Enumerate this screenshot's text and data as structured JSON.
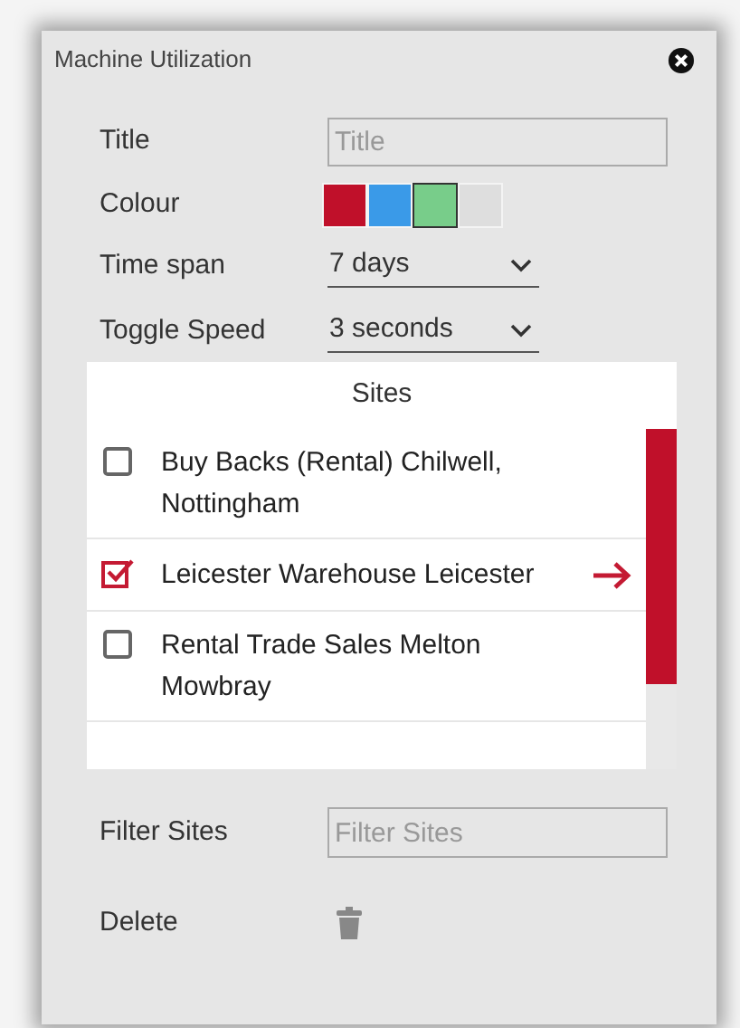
{
  "window": {
    "title": "Machine Utilization"
  },
  "form": {
    "title_label": "Title",
    "title_placeholder": "Title",
    "colour_label": "Colour",
    "colours": [
      {
        "color": "#c0102a",
        "selected": false
      },
      {
        "color": "#3a9ae8",
        "selected": false
      },
      {
        "color": "#78cd8a",
        "selected": true
      },
      {
        "color": "#dedede",
        "selected": false
      }
    ],
    "time_span_label": "Time span",
    "time_span_value": "7 days",
    "toggle_speed_label": "Toggle Speed",
    "toggle_speed_value": "3 seconds"
  },
  "sites": {
    "heading": "Sites",
    "items": [
      {
        "name": "Buy Backs (Rental) Chilwell, Nottingham",
        "checked": false,
        "selected": false
      },
      {
        "name": "Leicester Warehouse Leicester",
        "checked": true,
        "selected": true
      },
      {
        "name": "Rental Trade Sales Melton Mowbray",
        "checked": false,
        "selected": false
      }
    ]
  },
  "filter": {
    "label": "Filter Sites",
    "placeholder": "Filter Sites"
  },
  "delete": {
    "label": "Delete"
  }
}
